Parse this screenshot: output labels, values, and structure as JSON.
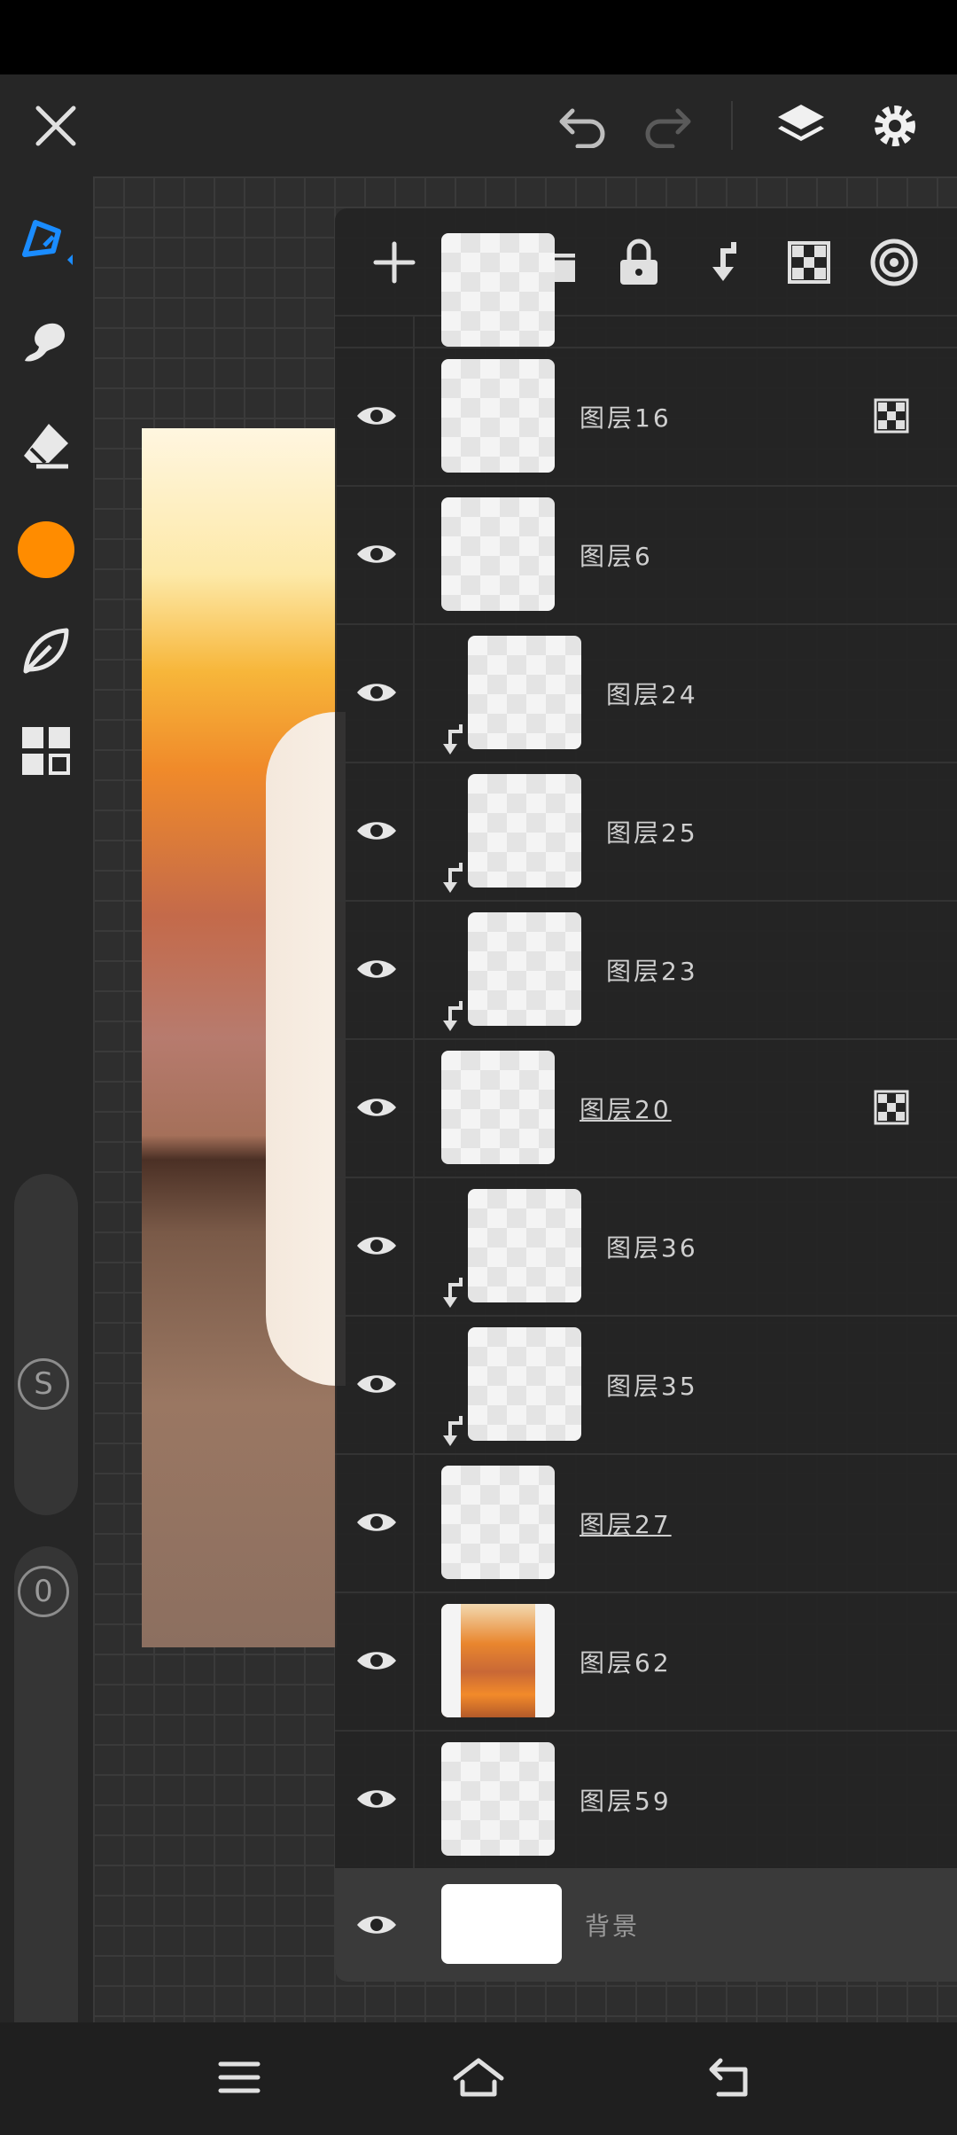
{
  "toolbar": {
    "icons": [
      "close-icon",
      "undo-icon",
      "redo-icon",
      "layers-icon",
      "settings-icon"
    ]
  },
  "sidebar": {
    "tools": [
      "pen-tool-icon",
      "smudge-tool-icon",
      "eraser-tool-icon",
      "color-swatch",
      "brush-library-icon",
      "gallery-icon"
    ],
    "accent_color": "#1a8cff",
    "current_color": "#ff8c00",
    "size_label": "S",
    "opacity_label": "0"
  },
  "layers_panel": {
    "toolbar": [
      "add-layer-icon",
      "folder-icon",
      "lock-icon",
      "merge-down-icon",
      "alpha-lock-icon",
      "blend-icon"
    ],
    "layers": [
      {
        "name": "图层16",
        "clipped": false,
        "alpha_lock": true,
        "underline": false
      },
      {
        "name": "图层6",
        "clipped": false,
        "alpha_lock": false,
        "underline": false
      },
      {
        "name": "图层24",
        "clipped": true,
        "alpha_lock": false,
        "underline": false
      },
      {
        "name": "图层25",
        "clipped": true,
        "alpha_lock": false,
        "underline": false
      },
      {
        "name": "图层23",
        "clipped": true,
        "alpha_lock": false,
        "underline": false
      },
      {
        "name": "图层20",
        "clipped": false,
        "alpha_lock": true,
        "underline": true
      },
      {
        "name": "图层36",
        "clipped": true,
        "alpha_lock": false,
        "underline": false
      },
      {
        "name": "图层35",
        "clipped": true,
        "alpha_lock": false,
        "underline": false
      },
      {
        "name": "图层27",
        "clipped": false,
        "alpha_lock": false,
        "underline": true
      },
      {
        "name": "图层62",
        "clipped": false,
        "alpha_lock": false,
        "underline": false
      },
      {
        "name": "图层59",
        "clipped": false,
        "alpha_lock": false,
        "underline": false
      }
    ],
    "background_layer": {
      "name": "背景"
    }
  },
  "navbar": {
    "icons": [
      "menu-icon",
      "home-icon",
      "back-icon"
    ]
  }
}
